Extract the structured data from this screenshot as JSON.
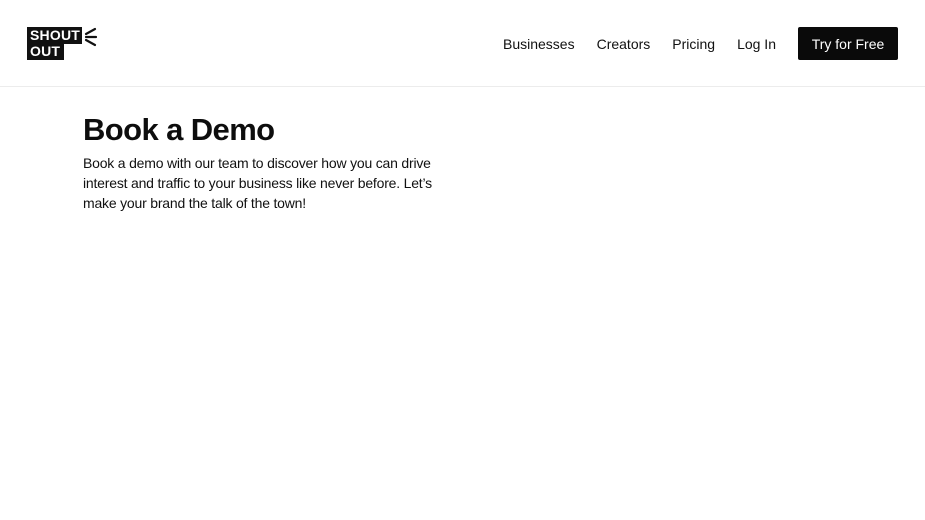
{
  "header": {
    "logo": {
      "line1": "SHOUT",
      "line2": "OUT"
    },
    "nav": {
      "businesses": "Businesses",
      "creators": "Creators",
      "pricing": "Pricing",
      "login": "Log In",
      "cta": "Try for Free"
    }
  },
  "hero": {
    "title": "Book a Demo",
    "description": "Book a demo with our team to discover how you can drive interest and traffic to your business like never before. Let’s make your brand the talk of the town!"
  },
  "colors": {
    "text": "#111111",
    "button_bg": "#0a0a0a",
    "button_text": "#ffffff",
    "divider": "#ececec"
  }
}
